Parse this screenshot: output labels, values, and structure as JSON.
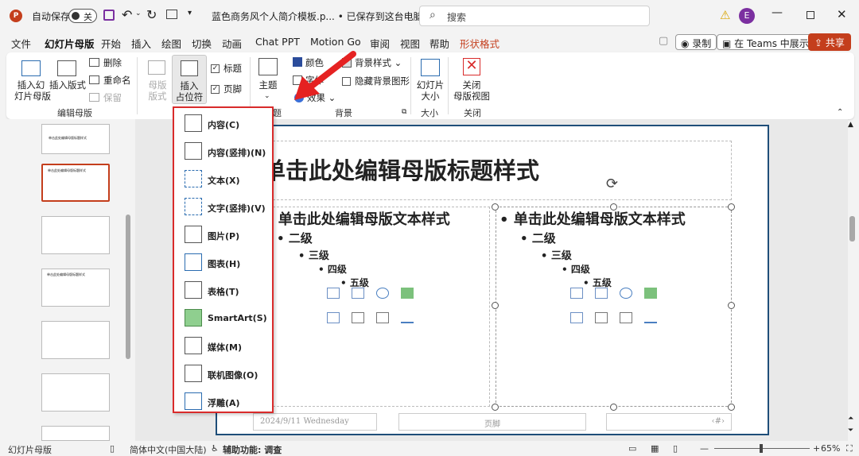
{
  "titlebar": {
    "autosave_label": "自动保存",
    "toggle_state": "关",
    "doc_title": "蓝色商务风个人简介模板.p... • 已保存到这台电脑",
    "search_placeholder": "搜索",
    "avatar_initial": "E"
  },
  "tabs": [
    "文件",
    "幻灯片母版",
    "开始",
    "插入",
    "绘图",
    "切换",
    "动画",
    "Chat PPT",
    "Motion Go",
    "审阅",
    "视图",
    "帮助",
    "形状格式"
  ],
  "header_buttons": {
    "record": "录制",
    "teams": "在 Teams 中展示",
    "share": "共享"
  },
  "ribbon": {
    "insert_slide_master": "插入幻\n灯片母版",
    "insert_layout": "插入版式",
    "delete": "删除",
    "rename": "重命名",
    "preserve": "保留",
    "group_edit_master": "编辑母版",
    "master_layout": "母版\n版式",
    "insert_placeholder": "插入\n占位符",
    "title_check": "标题",
    "footer_check": "页脚",
    "theme": "主题",
    "colors": "颜色",
    "fonts": "字体",
    "effects": "效果",
    "bg_styles": "背景样式",
    "hide_bg": "隐藏背景图形",
    "group_theme_suffix": "题",
    "group_background": "背景",
    "slide_size": "幻灯片\n大小",
    "group_size": "大小",
    "close_master": "关闭\n母版视图",
    "group_close": "关闭"
  },
  "dropdown_items": [
    {
      "label": "内容(C)",
      "icon": "content-icon"
    },
    {
      "label": "内容(竖排)(N)",
      "icon": "content-vertical-icon"
    },
    {
      "label": "文本(X)",
      "icon": "text-icon"
    },
    {
      "label": "文字(竖排)(V)",
      "icon": "text-vertical-icon"
    },
    {
      "label": "图片(P)",
      "icon": "picture-icon"
    },
    {
      "label": "图表(H)",
      "icon": "chart-icon"
    },
    {
      "label": "表格(T)",
      "icon": "table-icon"
    },
    {
      "label": "SmartArt(S)",
      "icon": "smartart-icon"
    },
    {
      "label": "媒体(M)",
      "icon": "media-icon"
    },
    {
      "label": "联机图像(O)",
      "icon": "online-image-icon"
    },
    {
      "label": "浮雕(A)",
      "icon": "cameo-icon"
    }
  ],
  "slide": {
    "title": "单击此处编辑母版标题样式",
    "level1": "• 单击此处编辑母版文本样式",
    "level2": "• 二级",
    "level3": "• 三级",
    "level4": "• 四级",
    "level5": "• 五级",
    "date": "2024/9/11 Wednesday",
    "footer": "页脚",
    "number": "‹#›"
  },
  "thumb_title": "单击此处编辑母版标题样式",
  "status": {
    "view": "幻灯片母版",
    "language": "简体中文(中国大陆)",
    "accessibility": "辅助功能: 调查",
    "zoom": "65%"
  },
  "colors": {
    "accent": "#c43e1c",
    "highlight": "#d92b2b",
    "slide_border": "#1f4e79"
  }
}
